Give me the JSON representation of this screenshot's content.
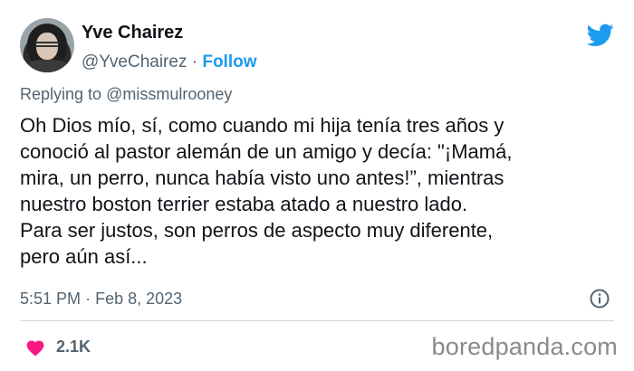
{
  "author": {
    "name": "Yve Chairez",
    "handle": "@YveChairez",
    "separator": "·",
    "follow_label": "Follow"
  },
  "reply": {
    "prefix": "Replying to",
    "mention": "@missmulrooney"
  },
  "tweet_lines": [
    "Oh Dios mío, sí, como cuando mi hija tenía tres años y",
    "conoció al pastor alemán de un amigo y decía: \"¡Mamá,",
    "mira, un perro, nunca había visto uno antes!”, mientras",
    "nuestro boston terrier estaba atado a nuestro lado.",
    "Para ser justos, son perros de aspecto muy diferente,",
    "pero aún así..."
  ],
  "timestamp": {
    "time": "5:51 PM",
    "separator": "·",
    "date": "Feb 8, 2023"
  },
  "likes": {
    "count": "2.1K"
  },
  "watermark": "boredpanda.com",
  "colors": {
    "twitter_blue": "#1d9bf0",
    "heart_pink": "#f91880",
    "secondary_text": "#536471"
  },
  "icons": {
    "brand": "twitter-bird-icon",
    "info": "info-icon",
    "like": "heart-icon"
  }
}
